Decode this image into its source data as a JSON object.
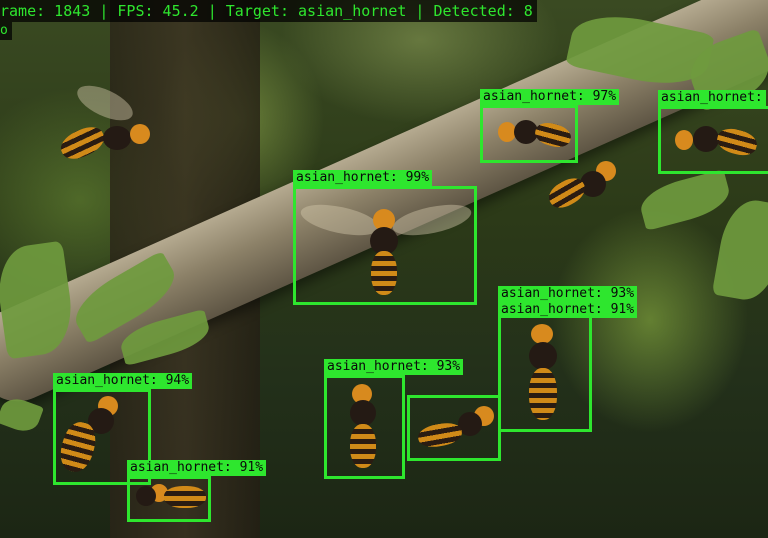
{
  "hud": {
    "line1": "rame: 1843 | FPS: 45.2 | Target: asian_hornet | Detected: 8",
    "line2": "o"
  },
  "detections": [
    {
      "label": "asian_hornet: 97%"
    },
    {
      "label": "asian_hornet:"
    },
    {
      "label": "asian_hornet: 99%"
    },
    {
      "label": "asian_hornet: 93%"
    },
    {
      "label": "asian_hornet: 91%"
    },
    {
      "label": "asian_hornet: 94%"
    },
    {
      "label": "asian_hornet: 93%"
    },
    {
      "label": "asian_hornet: 91%"
    }
  ],
  "colors": {
    "box": "#2ee62e",
    "hud_bg": "#000000"
  }
}
